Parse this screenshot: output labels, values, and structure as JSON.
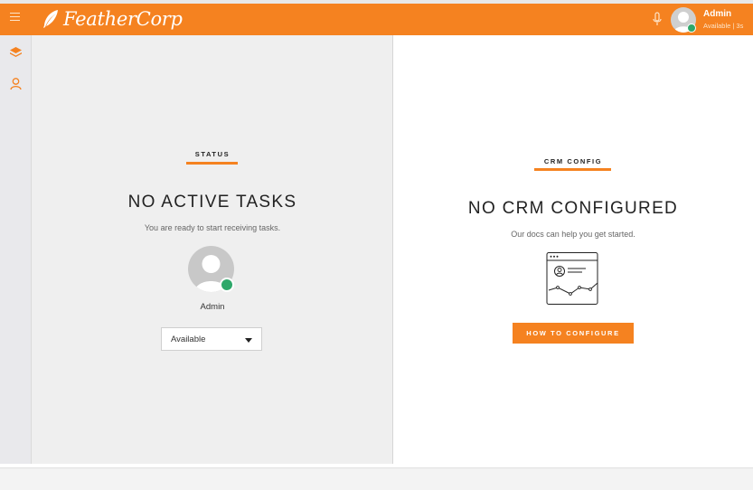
{
  "header": {
    "brand": "FeatherCorp",
    "user_name": "Admin",
    "user_status": "Available | 3s",
    "accent_color": "#f58220"
  },
  "sidebar": {
    "items": [
      {
        "icon": "layers-icon"
      },
      {
        "icon": "user-icon"
      }
    ]
  },
  "status_panel": {
    "section_label": "STATUS",
    "title": "NO ACTIVE TASKS",
    "subtitle": "You are ready to start receiving tasks.",
    "agent_name": "Admin",
    "availability_value": "Available",
    "status_color": "#2ea86a"
  },
  "crm_panel": {
    "section_label": "CRM CONFIG",
    "title": "NO CRM CONFIGURED",
    "subtitle": "Our docs can help you get started.",
    "button_label": "HOW TO CONFIGURE"
  }
}
